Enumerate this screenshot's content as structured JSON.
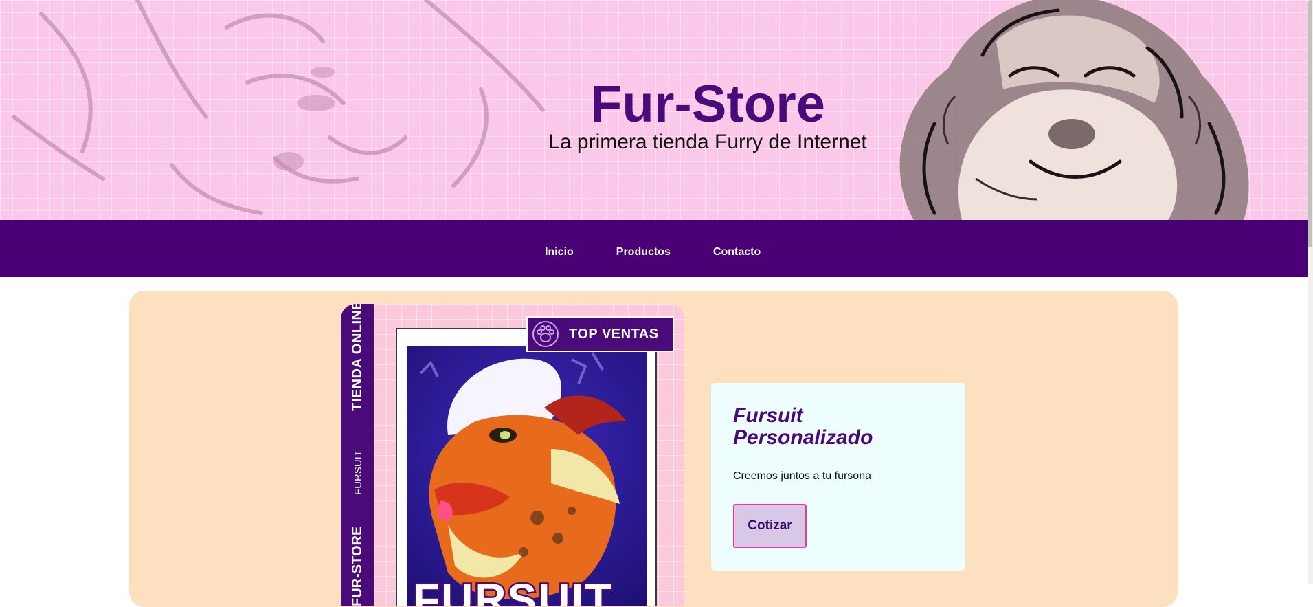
{
  "header": {
    "title": "Fur-Store",
    "subtitle": "La primera tienda Furry de Internet"
  },
  "nav": {
    "items": [
      {
        "label": "Inicio"
      },
      {
        "label": "Productos"
      },
      {
        "label": "Contacto"
      }
    ]
  },
  "featured": {
    "side_strip_main": "TIENDA ONLINE",
    "side_strip_sub": "FURSUIT",
    "side_strip_bottom": "FUR-STORE",
    "badge_label": "TOP VENTAS",
    "image_caption": "FURSUIT",
    "badge_icon": "paw-icon"
  },
  "product": {
    "title": "Fursuit Personalizado",
    "description": "Creemos juntos a tu fursona",
    "button_label": "Cotizar"
  },
  "colors": {
    "hero_bg": "#fbc8ea",
    "nav_bg": "#490075",
    "card_bg": "#fde0bf",
    "info_bg": "#eefefe",
    "accent_purple": "#4a0a7a",
    "button_border": "#e3418f",
    "button_bg": "#d7c8e8"
  }
}
